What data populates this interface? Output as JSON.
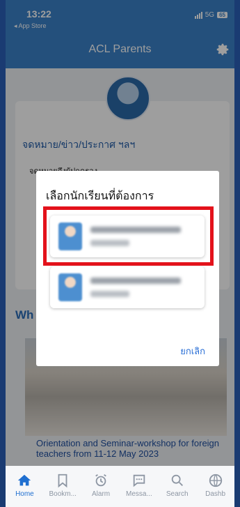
{
  "status_bar": {
    "time": "13:22",
    "back_label": "◂ App Store",
    "network": "5G",
    "battery": "65"
  },
  "header": {
    "title": "ACL Parents"
  },
  "card": {
    "title": "จดหมาย/ข่าว/ประกาศ ฯลฯ",
    "subtitle": "จดหมายถึงผู้ปกครอง"
  },
  "section": {
    "title": "Wh"
  },
  "news": {
    "caption": "Orientation and Seminar-workshop for foreign teachers from 11-12 May 2023"
  },
  "modal": {
    "title": "เลือกนักเรียนที่ต้องการ",
    "cancel_label": "ยกเลิก",
    "students": [
      "",
      ""
    ]
  },
  "tabbar": {
    "items": [
      {
        "label": "Home",
        "icon": "home-icon",
        "active": true
      },
      {
        "label": "Bookm...",
        "icon": "bookmark-icon"
      },
      {
        "label": "Alarm",
        "icon": "alarm-icon"
      },
      {
        "label": "Messa...",
        "icon": "message-icon"
      },
      {
        "label": "Search",
        "icon": "search-icon"
      },
      {
        "label": "Dashb",
        "icon": "dashboard-icon"
      }
    ]
  },
  "colors": {
    "header": "#3b82c9",
    "accent": "#1f6fd0",
    "highlight": "#e3121b"
  }
}
